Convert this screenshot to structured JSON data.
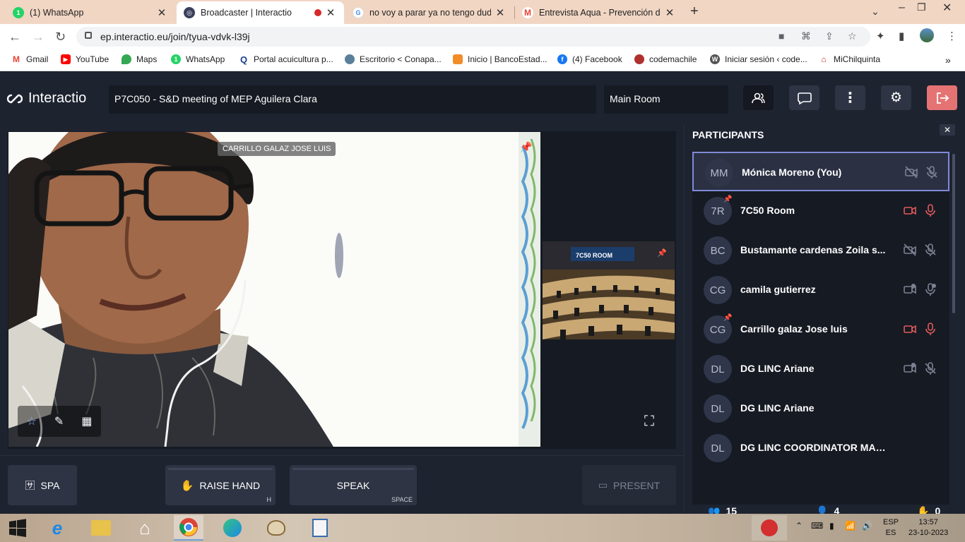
{
  "browser": {
    "tabs": [
      {
        "title": "(1) WhatsApp",
        "icon": "whatsapp-icon"
      },
      {
        "title": "Broadcaster | Interactio",
        "icon": "interactio-icon"
      },
      {
        "title": "no voy a parar ya no tengo duda",
        "icon": "google-icon"
      },
      {
        "title": "Entrevista Aqua - Prevención de",
        "icon": "gmail-icon"
      }
    ],
    "url": "ep.interactio.eu/join/tyua-vdvk-l39j",
    "bookmarks": [
      {
        "label": "Gmail",
        "icon": "gmail-icon"
      },
      {
        "label": "YouTube",
        "icon": "youtube-icon"
      },
      {
        "label": "Maps",
        "icon": "maps-icon"
      },
      {
        "label": "WhatsApp",
        "icon": "whatsapp-icon"
      },
      {
        "label": "Portal acuicultura p...",
        "icon": "q-icon"
      },
      {
        "label": "Escritorio < Conapa...",
        "icon": "globe-icon"
      },
      {
        "label": "Inicio | BancoEstad...",
        "icon": "bank-icon"
      },
      {
        "label": "(4) Facebook",
        "icon": "facebook-icon"
      },
      {
        "label": "codemachile",
        "icon": "codema-icon"
      },
      {
        "label": "Iniciar sesión ‹ code...",
        "icon": "wordpress-icon"
      },
      {
        "label": "MiChilquinta",
        "icon": "home-icon"
      }
    ]
  },
  "app": {
    "logo": "Interactio",
    "event_name": "P7C050 - S&D meeting of MEP Aguilera Clara",
    "room": "Main Room",
    "main_speaker": "CARRILLO GALAZ JOSE LUIS",
    "tile_name": "7C50 ROOM",
    "language_button": "SPA",
    "raise_hand": {
      "label": "RAISE HAND",
      "key": "H"
    },
    "speak": {
      "label": "SPEAK",
      "key": "SPACE"
    },
    "present": "PRESENT"
  },
  "participants": {
    "title": "PARTICIPANTS",
    "list": [
      {
        "initials": "MM",
        "name": "Mónica Moreno (You)",
        "video": "off",
        "mic": "off",
        "pinned": false
      },
      {
        "initials": "7R",
        "name": "7C50 Room",
        "video": "on",
        "mic": "on",
        "pinned": true
      },
      {
        "initials": "BC",
        "name": "Bustamante cardenas Zoila s...",
        "video": "off",
        "mic": "off",
        "pinned": false
      },
      {
        "initials": "CG",
        "name": "camila gutierrez",
        "video": "request",
        "mic": "request",
        "pinned": false
      },
      {
        "initials": "CG",
        "name": "Carrillo galaz Jose luis",
        "video": "on",
        "mic": "on",
        "pinned": true
      },
      {
        "initials": "DL",
        "name": "DG LINC Ariane",
        "video": "request",
        "mic": "off",
        "pinned": false
      },
      {
        "initials": "DL",
        "name": "DG LINC Ariane",
        "video": "none",
        "mic": "none",
        "pinned": false
      },
      {
        "initials": "DL",
        "name": "DG LINC COORDINATOR MARION N-G",
        "video": "none",
        "mic": "none",
        "pinned": false
      }
    ],
    "count_total": "15",
    "count_speakers": "4",
    "count_hands": "0"
  },
  "taskbar": {
    "language": "ESP",
    "language2": "ES",
    "time": "13:57",
    "date": "23-10-2023"
  },
  "colors": {
    "bg": "#1e2330",
    "panel": "#161a23",
    "button": "#2e3444",
    "exit": "#e57373",
    "active_red": "#e05a5a",
    "you_border": "#7f8ad6"
  }
}
